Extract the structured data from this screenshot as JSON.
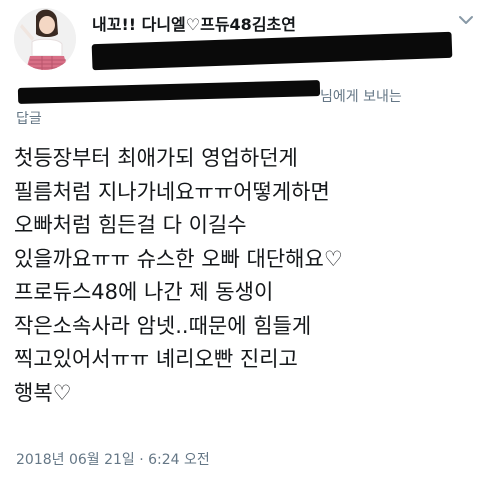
{
  "tweet": {
    "display_name": "내꼬!! 다니엘♡프듀48김초연",
    "reply_to_suffix": "님에게 보내는",
    "reply_to_line2": "답글",
    "body_lines": [
      "첫등장부터 최애가되 영업하던게",
      "필름처럼 지나가네요ㅠㅠ어떻게하면",
      "오빠처럼 힘든걸 다 이길수",
      "있을까요ㅠㅠ 슈스한 오빠 대단해요♡",
      "프로듀스48에 나간 제 동생이",
      "작은소속사라 암넷..때문에 힘들게",
      "찍고있어서ㅠㅠ 녜리오빤 진리고",
      "행복♡"
    ],
    "timestamp": "2018년 06월 21일 · 6:24 오전",
    "chevron_icon": "chevron-down-icon",
    "avatar_icon": "profile-avatar"
  }
}
